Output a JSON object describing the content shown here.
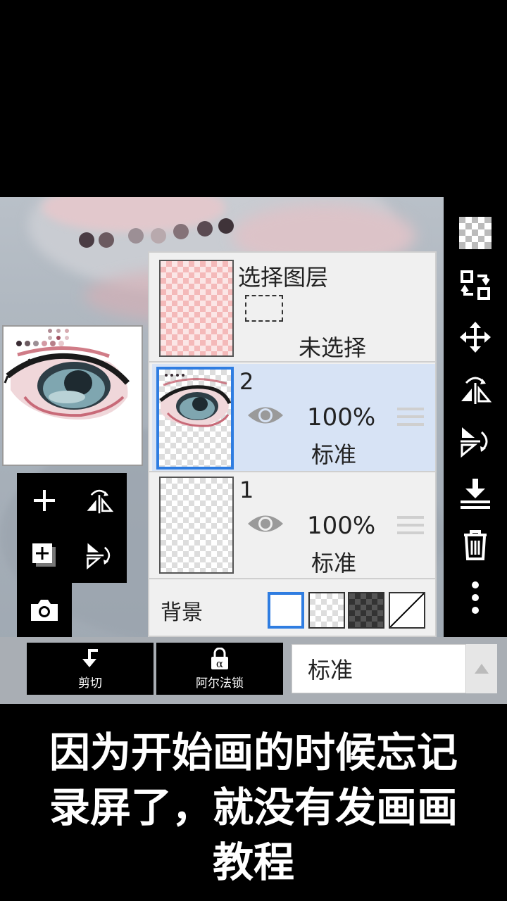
{
  "layer_panel": {
    "selection_layer": {
      "title": "选择图层",
      "status": "未选择"
    },
    "layers": [
      {
        "number": "2",
        "opacity": "100%",
        "blend": "标准",
        "selected": true
      },
      {
        "number": "1",
        "opacity": "100%",
        "blend": "标准",
        "selected": false
      }
    ],
    "background": {
      "label": "背景",
      "selected_swatch": "white"
    }
  },
  "right_toolbar": {
    "icons": [
      "transparency-icon",
      "layer-swap-icon",
      "move-icon",
      "flip-horizontal-icon",
      "flip-vertical-icon",
      "merge-down-icon",
      "trash-icon",
      "more-vertical-icon"
    ]
  },
  "left_tools": {
    "icons": [
      "add-layer-icon",
      "flip-horizontal-icon",
      "add-copy-icon",
      "flip-vertical-icon",
      "camera-icon"
    ]
  },
  "bottom_bar": {
    "clip_label": "剪切",
    "alpha_lock_label": "阿尔法锁",
    "blend_mode": "标准"
  },
  "subtitle": {
    "line1": "因为开始画的时候忘记",
    "line2": "录屏了，就没有发画画",
    "line3": "教程"
  },
  "colors": {
    "accent": "#2f7de1",
    "active_row": "#d7e3f5"
  }
}
